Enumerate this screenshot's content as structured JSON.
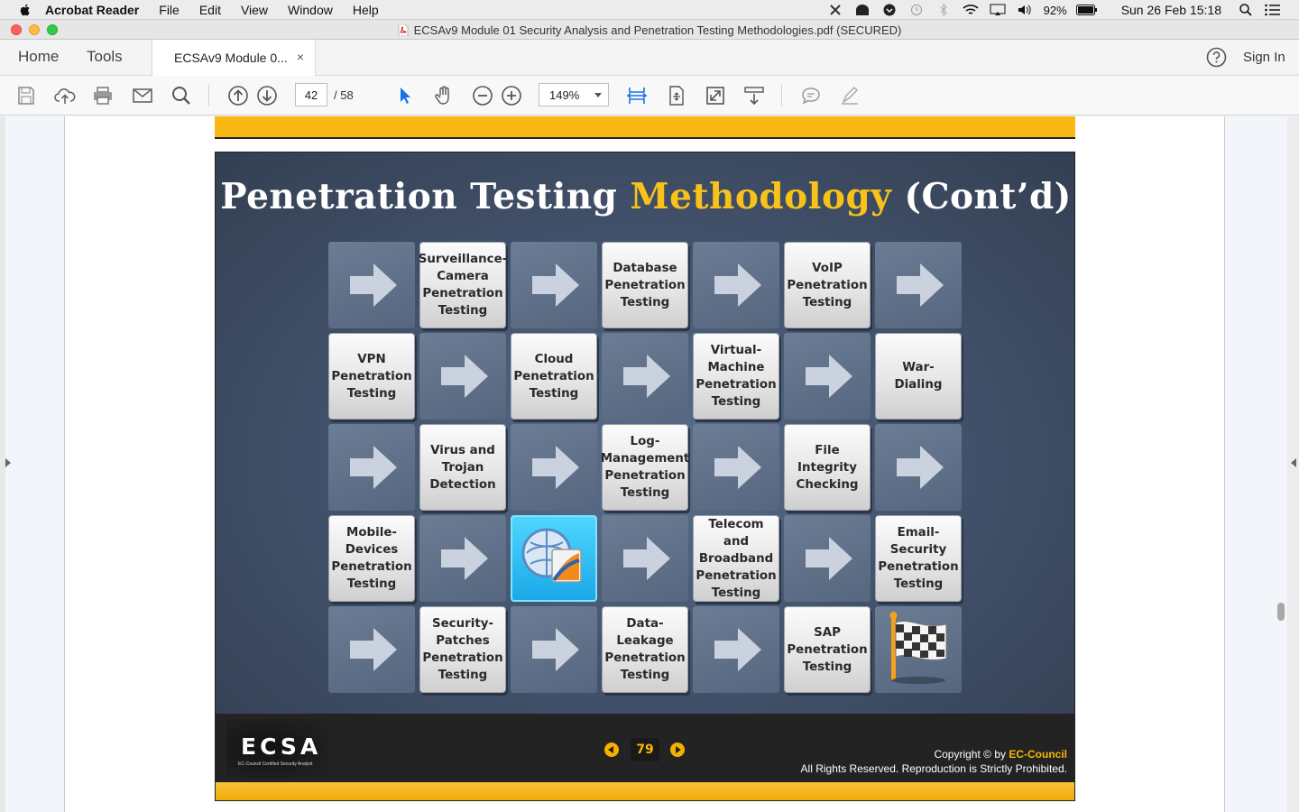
{
  "menubar": {
    "app_name": "Acrobat Reader",
    "items": [
      "File",
      "Edit",
      "View",
      "Window",
      "Help"
    ],
    "battery": "92%",
    "clock": "Sun 26 Feb  15:18"
  },
  "window": {
    "title": "ECSAv9 Module 01 Security Analysis and Penetration Testing Methodologies.pdf (SECURED)"
  },
  "tabs": {
    "home": "Home",
    "tools": "Tools",
    "document": "ECSAv9 Module 0...",
    "close": "×",
    "sign_in": "Sign In"
  },
  "toolbar": {
    "current_page": "42",
    "total_pages": "/  58",
    "zoom": "149%"
  },
  "slide": {
    "title_part1": "Penetration Testing ",
    "title_highlight": "Methodology",
    "title_part2": " (Cont’d)",
    "cells": {
      "surveillance": "Surveillance-Camera Penetration Testing",
      "database": "Database Penetration Testing",
      "voip": "VoIP Penetration Testing",
      "vpn": "VPN Penetration Testing",
      "cloud": "Cloud Penetration Testing",
      "virtual_machine": "Virtual-Machine Penetration Testing",
      "war_dialing": "War-Dialing",
      "virus": "Virus and Trojan Detection",
      "log_management": "Log-Management Penetration Testing",
      "file_integrity": "File Integrity Checking",
      "mobile": "Mobile-Devices Penetration Testing",
      "telecom": "Telecom and Broadband Penetration Testing",
      "email": "Email-Security Penetration Testing",
      "security_patches": "Security-Patches Penetration Testing",
      "data_leakage": "Data-Leakage Penetration Testing",
      "sap": "SAP Penetration Testing"
    },
    "footer": {
      "logo": "ECSA",
      "logo_sub": "EC-Council Certified Security Analyst",
      "slide_number": "79",
      "copyright_prefix": "Copyright © by ",
      "copyright_brand": "EC-Council",
      "rights": "All Rights Reserved. Reproduction is Strictly Prohibited."
    }
  },
  "colors": {
    "slide_highlight": "#f8c21b",
    "slide_background": "#3a4a60",
    "footer_strip": "#f0a900",
    "toolbar_accent": "#1473e6"
  }
}
